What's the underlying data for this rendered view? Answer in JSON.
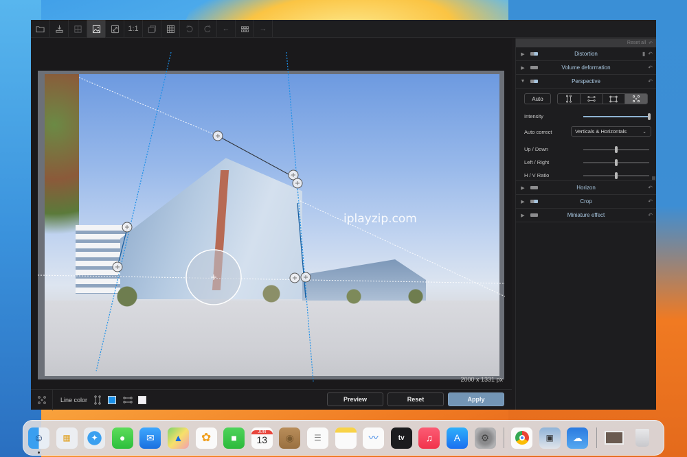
{
  "toolbar": {
    "buttons": [
      {
        "name": "open-folder",
        "label": ""
      },
      {
        "name": "export",
        "label": ""
      },
      {
        "name": "compare-view",
        "label": ""
      },
      {
        "name": "image-view",
        "label": "",
        "active": true
      },
      {
        "name": "fit-screen",
        "label": ""
      },
      {
        "name": "actual-size",
        "label": "1:1"
      },
      {
        "name": "stack",
        "label": ""
      },
      {
        "name": "grid",
        "label": ""
      },
      {
        "name": "undo",
        "label": ""
      },
      {
        "name": "redo",
        "label": ""
      },
      {
        "name": "previous",
        "label": "←"
      },
      {
        "name": "browser-grid",
        "label": ""
      },
      {
        "name": "next",
        "label": "→"
      }
    ]
  },
  "canvas": {
    "watermark": "iplayzip.com",
    "image_dimensions": "2000 x 1331 px"
  },
  "bottom_bar": {
    "line_color_label": "Line color",
    "vertical_line_color": "#1a8fe8",
    "horizontal_line_color": "#f2f0f4",
    "preview_label": "Preview",
    "reset_label": "Reset",
    "apply_label": "Apply"
  },
  "panel": {
    "reset_all_label": "Reset all",
    "sections": {
      "distortion": {
        "title": "Distortion",
        "expanded": false,
        "enabled": true
      },
      "volume_deformation": {
        "title": "Volume deformation",
        "expanded": false,
        "enabled": false
      },
      "perspective": {
        "title": "Perspective",
        "expanded": true,
        "enabled": true
      },
      "horizon": {
        "title": "Horizon",
        "expanded": false,
        "enabled": false
      },
      "crop": {
        "title": "Crop",
        "expanded": false,
        "enabled": true
      },
      "miniature_effect": {
        "title": "Miniature effect",
        "expanded": false,
        "enabled": false
      }
    },
    "perspective": {
      "auto_label": "Auto",
      "modes": [
        "verticals",
        "horizontals",
        "rectangle",
        "points"
      ],
      "active_mode": "points",
      "intensity_label": "Intensity",
      "intensity_value": 1.0,
      "auto_correct_label": "Auto correct",
      "auto_correct_value": "Verticals & Horizontals",
      "up_down_label": "Up / Down",
      "up_down_value": 0.5,
      "left_right_label": "Left / Right",
      "left_right_value": 0.5,
      "hv_ratio_label": "H / V Ratio",
      "hv_ratio_value": 0.5
    }
  },
  "dock": {
    "apps": [
      "Finder",
      "Launchpad",
      "Safari",
      "Messages",
      "Mail",
      "Maps",
      "Photos",
      "FaceTime",
      "Calendar",
      "Contacts",
      "Reminders",
      "Notes",
      "Freeform",
      "Apple TV",
      "Music",
      "App Store",
      "System Settings",
      "Google Chrome",
      "Preview",
      "Weather",
      "Image Capture",
      "Trash"
    ],
    "calendar_month": "JUN",
    "calendar_day": "13",
    "tv_label": "tv"
  }
}
